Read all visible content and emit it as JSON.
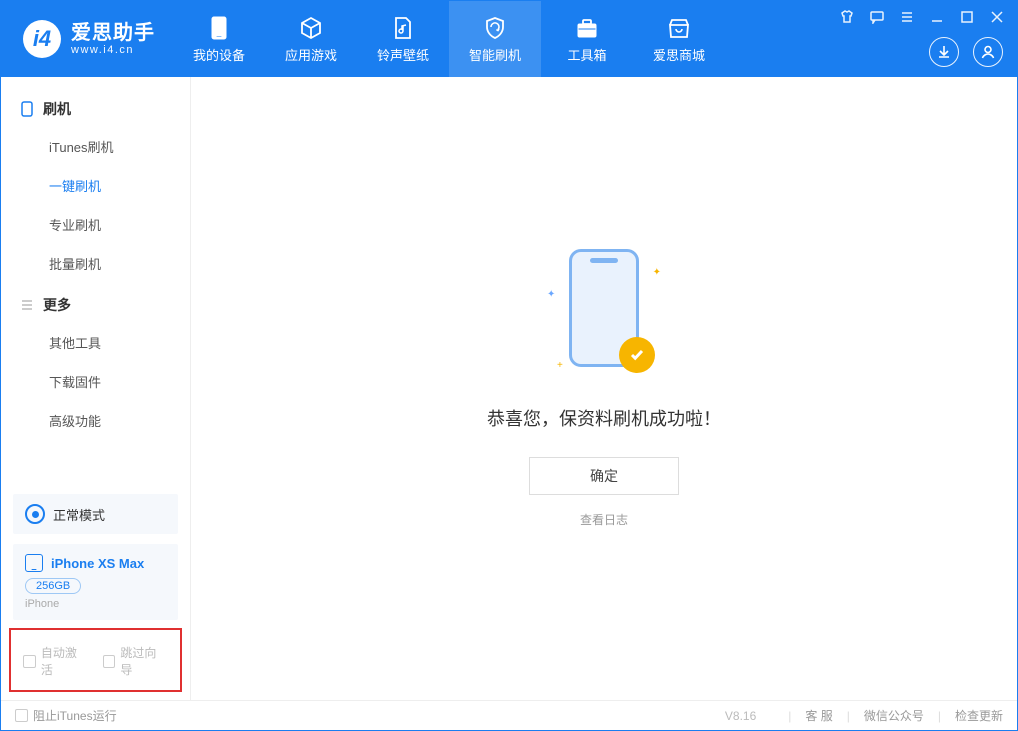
{
  "app": {
    "title": "爱思助手",
    "subtitle": "www.i4.cn"
  },
  "nav": {
    "items": [
      {
        "label": "我的设备"
      },
      {
        "label": "应用游戏"
      },
      {
        "label": "铃声壁纸"
      },
      {
        "label": "智能刷机"
      },
      {
        "label": "工具箱"
      },
      {
        "label": "爱思商城"
      }
    ],
    "activeIndex": 3
  },
  "sidebar": {
    "group_flash": {
      "title": "刷机",
      "items": [
        {
          "label": "iTunes刷机"
        },
        {
          "label": "一键刷机"
        },
        {
          "label": "专业刷机"
        },
        {
          "label": "批量刷机"
        }
      ],
      "activeIndex": 1
    },
    "group_more": {
      "title": "更多",
      "items": [
        {
          "label": "其他工具"
        },
        {
          "label": "下载固件"
        },
        {
          "label": "高级功能"
        }
      ]
    },
    "mode": {
      "label": "正常模式"
    },
    "device": {
      "name": "iPhone XS Max",
      "storage": "256GB",
      "type": "iPhone"
    },
    "checkboxes": {
      "auto_activate": "自动激活",
      "skip_guide": "跳过向导"
    }
  },
  "main": {
    "success_text": "恭喜您，保资料刷机成功啦！",
    "ok_label": "确定",
    "view_log": "查看日志"
  },
  "footer": {
    "block_itunes": "阻止iTunes运行",
    "version": "V8.16",
    "links": {
      "service": "客 服",
      "wechat": "微信公众号",
      "update": "检查更新"
    }
  }
}
